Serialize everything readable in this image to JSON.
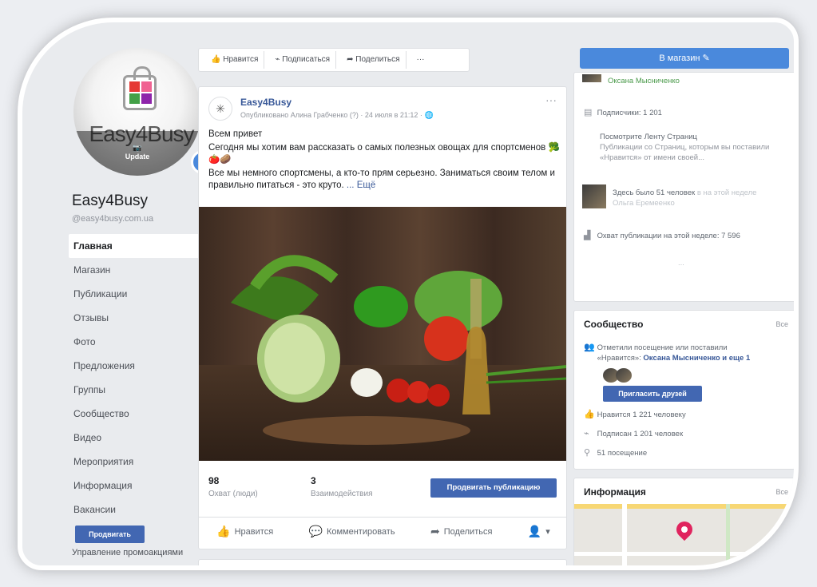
{
  "page": {
    "name": "Easy4Busy",
    "handle": "@easy4busy.com.ua",
    "avatar_logo_text": "Easy4Busy",
    "avatar_update_label": "Update"
  },
  "nav": {
    "items": [
      {
        "label": "Главная",
        "active": true
      },
      {
        "label": "Магазин"
      },
      {
        "label": "Публикации"
      },
      {
        "label": "Отзывы"
      },
      {
        "label": "Фото"
      },
      {
        "label": "Предложения"
      },
      {
        "label": "Группы"
      },
      {
        "label": "Сообщество"
      },
      {
        "label": "Видео"
      },
      {
        "label": "Мероприятия"
      },
      {
        "label": "Информация"
      },
      {
        "label": "Вакансии"
      }
    ],
    "promote_button": "Продвигать",
    "manage_promotions": "Управление промоакциями"
  },
  "topbar": {
    "like": "Нравится",
    "subscribe": "Подписаться",
    "share": "Поделиться",
    "more": "···"
  },
  "post": {
    "author": "Easy4Busy",
    "meta": "Опубликовано Алина Грабченко (?) · 24 июля в 21:12 ·",
    "more": "···",
    "greeting": "Всем привет",
    "line1": "Сегодня мы хотим вам рассказать о самых полезных овощах для спортсменов 🥦🍅🥔",
    "line2": "Все мы немного спортсмены, а кто-то прям серьезно. Заниматься своим телом и правильно питаться - это круто.",
    "see_more": "... Ещё",
    "reach_value": "98",
    "reach_label": "Охват (люди)",
    "engagement_value": "3",
    "engagement_label": "Взаимодействия",
    "boost_button": "Продвигать публикацию",
    "like_action": "Нравится",
    "comment_action": "Комментировать",
    "share_action": "Поделиться"
  },
  "right": {
    "shop_button": "В магазин ✎",
    "top_card": {
      "oksana": "Оксана Мысниченко",
      "followers": "Подписчики: 1 201",
      "view_feed_title": "Посмотрите Ленту Страниц",
      "view_feed_desc": "Публикации со Страниц, которым вы поставили «Нравится» от имени своей...",
      "checkins_text": "Здесь было 51 человек",
      "checkins_sub": "в на этой неделе",
      "checkins_name": "Ольга Еремеенко",
      "reach_week": "Охват публикации на этой неделе: 7 596",
      "dots": "..."
    },
    "community": {
      "title": "Сообщество",
      "all": "Все",
      "invite_text": "Отметили посещение или поставили «Нравится»:",
      "invite_names": "Оксана Мысниченко и еще 1",
      "invite_button": "Пригласить друзей",
      "likes": "Нравится 1 221 человеку",
      "follows": "Подписан 1 201 человек",
      "visits": "51 посещение"
    },
    "info": {
      "title": "Информация",
      "all": "Все"
    }
  },
  "colors": {
    "brand_blue": "#4267b2",
    "link_blue": "#385898",
    "shop_blue": "#4a89dc",
    "map_pin": "#e0245e"
  }
}
